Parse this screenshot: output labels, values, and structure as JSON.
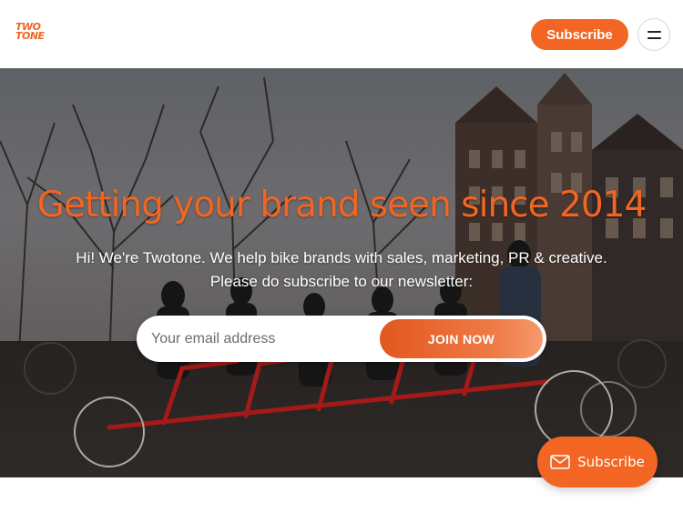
{
  "header": {
    "logo_line1": "TWO",
    "logo_line2": "TONE",
    "subscribe_label": "Subscribe",
    "menu_icon": "hamburger-icon"
  },
  "hero": {
    "title": "Getting your brand seen since 2014",
    "intro_line1": "Hi! We're Twotone. We help bike brands with sales, marketing, PR & creative.",
    "intro_line2": "Please do subscribe to our newsletter:",
    "email_placeholder": "Your email address",
    "join_label": "JOIN NOW"
  },
  "floating": {
    "subscribe_label": "Subscribe",
    "icon": "mail-icon"
  },
  "colors": {
    "brand_orange": "#f26522",
    "white": "#ffffff"
  }
}
